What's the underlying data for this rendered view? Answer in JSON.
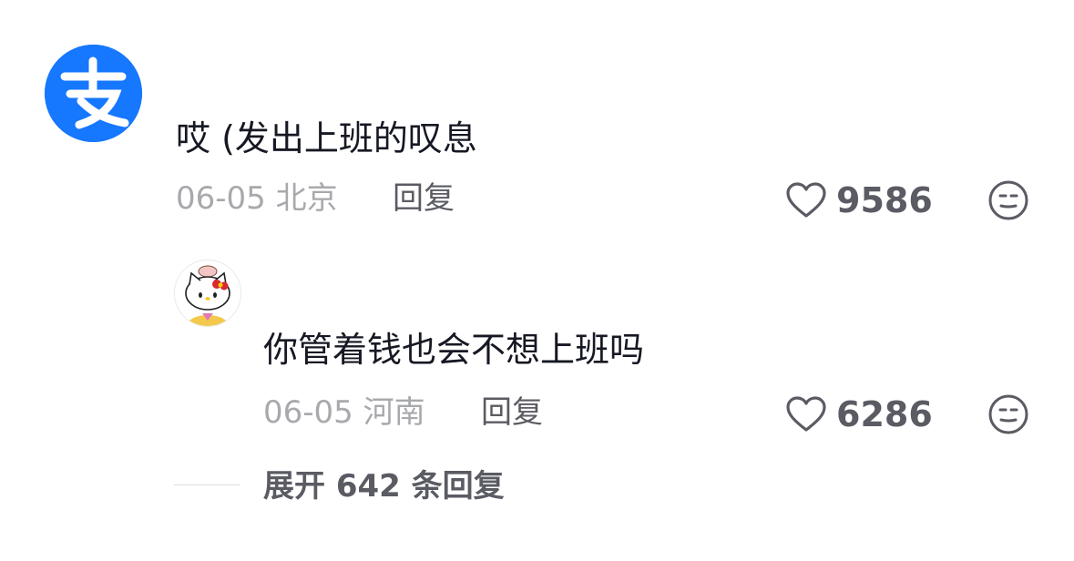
{
  "comment": {
    "avatar": {
      "icon": "alipay-logo-icon",
      "color": "#1677ff"
    },
    "text": "哎 (发出上班的叹息",
    "date": "06-05",
    "location": "北京",
    "reply_label": "回复",
    "like_count": "9586",
    "like_icon": "heart-outline-icon",
    "dislike_icon": "meh-face-icon"
  },
  "reply": {
    "avatar": {
      "icon": "hello-kitty-avatar"
    },
    "text": "你管着钱也会不想上班吗",
    "date": "06-05",
    "location": "河南",
    "reply_label": "回复",
    "like_count": "6286",
    "like_icon": "heart-outline-icon",
    "dislike_icon": "meh-face-icon"
  },
  "expand": {
    "label": "展开 642 条回复"
  }
}
